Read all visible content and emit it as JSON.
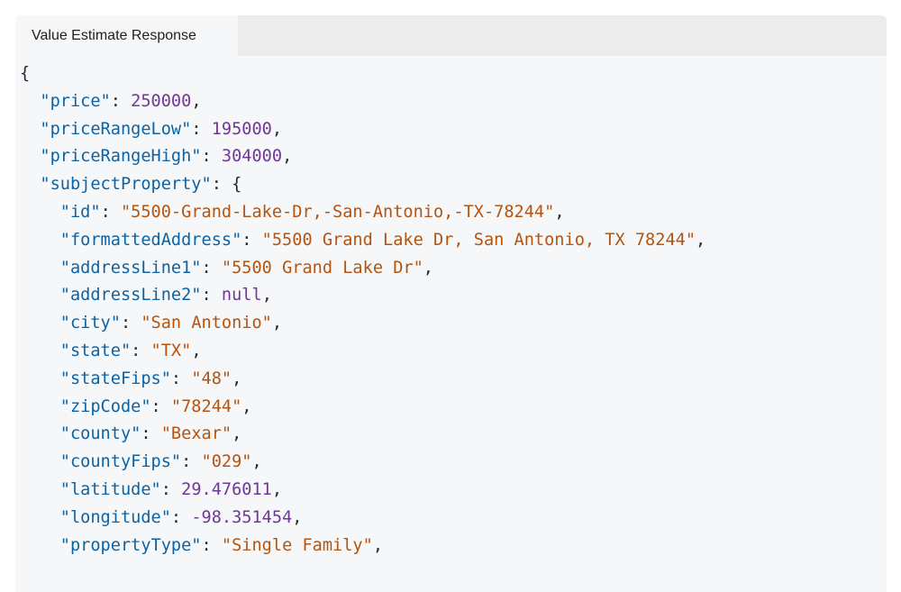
{
  "tab": {
    "label": "Value Estimate Response"
  },
  "colors": {
    "key": "#0b63a5",
    "string": "#b4540f",
    "number": "#6f3796",
    "punctuation": "#24292e"
  },
  "code_lines": [
    {
      "indent": "",
      "open": "{"
    },
    {
      "indent": "  ",
      "key": "\"price\"",
      "value": "250000",
      "type": "n",
      "trail": ","
    },
    {
      "indent": "  ",
      "key": "\"priceRangeLow\"",
      "value": "195000",
      "type": "n",
      "trail": ","
    },
    {
      "indent": "  ",
      "key": "\"priceRangeHigh\"",
      "value": "304000",
      "type": "n",
      "trail": ","
    },
    {
      "indent": "  ",
      "key": "\"subjectProperty\"",
      "value": "{",
      "type": "p",
      "trail": ""
    },
    {
      "indent": "    ",
      "key": "\"id\"",
      "value": "\"5500-Grand-Lake-Dr,-San-Antonio,-TX-78244\"",
      "type": "s",
      "trail": ","
    },
    {
      "indent": "    ",
      "key": "\"formattedAddress\"",
      "value": "\"5500 Grand Lake Dr, San Antonio, TX 78244\"",
      "type": "s",
      "trail": ","
    },
    {
      "indent": "    ",
      "key": "\"addressLine1\"",
      "value": "\"5500 Grand Lake Dr\"",
      "type": "s",
      "trail": ","
    },
    {
      "indent": "    ",
      "key": "\"addressLine2\"",
      "value": "null",
      "type": "n",
      "trail": ","
    },
    {
      "indent": "    ",
      "key": "\"city\"",
      "value": "\"San Antonio\"",
      "type": "s",
      "trail": ","
    },
    {
      "indent": "    ",
      "key": "\"state\"",
      "value": "\"TX\"",
      "type": "s",
      "trail": ","
    },
    {
      "indent": "    ",
      "key": "\"stateFips\"",
      "value": "\"48\"",
      "type": "s",
      "trail": ","
    },
    {
      "indent": "    ",
      "key": "\"zipCode\"",
      "value": "\"78244\"",
      "type": "s",
      "trail": ","
    },
    {
      "indent": "    ",
      "key": "\"county\"",
      "value": "\"Bexar\"",
      "type": "s",
      "trail": ","
    },
    {
      "indent": "    ",
      "key": "\"countyFips\"",
      "value": "\"029\"",
      "type": "s",
      "trail": ","
    },
    {
      "indent": "    ",
      "key": "\"latitude\"",
      "value": "29.476011",
      "type": "n",
      "trail": ","
    },
    {
      "indent": "    ",
      "key": "\"longitude\"",
      "value": "-98.351454",
      "type": "n",
      "trail": ","
    },
    {
      "indent": "    ",
      "key": "\"propertyType\"",
      "value": "\"Single Family\"",
      "type": "s",
      "trail": ","
    }
  ]
}
